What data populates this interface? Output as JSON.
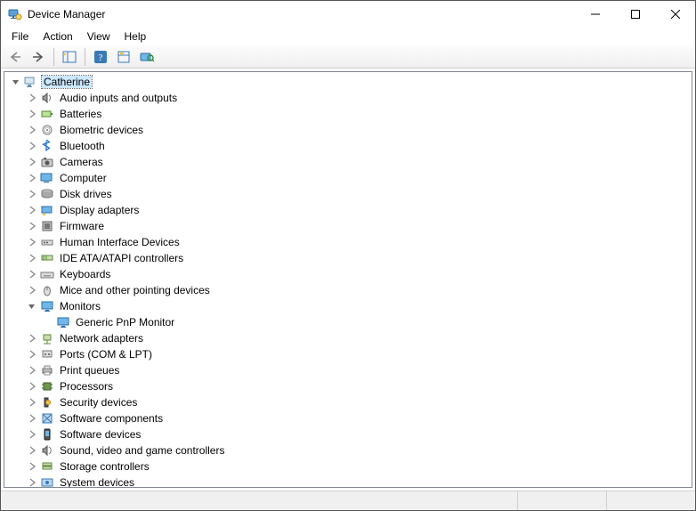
{
  "window": {
    "title": "Device Manager"
  },
  "menu": {
    "file": "File",
    "action": "Action",
    "view": "View",
    "help": "Help"
  },
  "toolbar": {
    "back": "Back",
    "forward": "Forward",
    "show_hide_tree": "Show/Hide Console Tree",
    "help": "Help",
    "properties": "Properties",
    "scan": "Scan for hardware changes"
  },
  "tree": {
    "root": {
      "label": "Catherine",
      "icon": "computer-root-icon",
      "expanded": true,
      "selected": true
    },
    "nodes": [
      {
        "label": "Audio inputs and outputs",
        "icon": "speaker-icon"
      },
      {
        "label": "Batteries",
        "icon": "battery-icon"
      },
      {
        "label": "Biometric devices",
        "icon": "fingerprint-icon"
      },
      {
        "label": "Bluetooth",
        "icon": "bluetooth-icon"
      },
      {
        "label": "Cameras",
        "icon": "camera-icon"
      },
      {
        "label": "Computer",
        "icon": "computer-icon"
      },
      {
        "label": "Disk drives",
        "icon": "disk-icon"
      },
      {
        "label": "Display adapters",
        "icon": "display-adapter-icon"
      },
      {
        "label": "Firmware",
        "icon": "firmware-icon"
      },
      {
        "label": "Human Interface Devices",
        "icon": "hid-icon"
      },
      {
        "label": "IDE ATA/ATAPI controllers",
        "icon": "ide-icon"
      },
      {
        "label": "Keyboards",
        "icon": "keyboard-icon"
      },
      {
        "label": "Mice and other pointing devices",
        "icon": "mouse-icon"
      },
      {
        "label": "Monitors",
        "icon": "monitor-icon",
        "expanded": true,
        "children": [
          {
            "label": "Generic PnP Monitor",
            "icon": "monitor-icon"
          }
        ]
      },
      {
        "label": "Network adapters",
        "icon": "network-icon"
      },
      {
        "label": "Ports (COM & LPT)",
        "icon": "port-icon"
      },
      {
        "label": "Print queues",
        "icon": "printer-icon"
      },
      {
        "label": "Processors",
        "icon": "cpu-icon"
      },
      {
        "label": "Security devices",
        "icon": "security-icon"
      },
      {
        "label": "Software components",
        "icon": "software-component-icon"
      },
      {
        "label": "Software devices",
        "icon": "software-device-icon"
      },
      {
        "label": "Sound, video and game controllers",
        "icon": "sound-icon"
      },
      {
        "label": "Storage controllers",
        "icon": "storage-icon"
      },
      {
        "label": "System devices",
        "icon": "system-icon"
      }
    ]
  }
}
